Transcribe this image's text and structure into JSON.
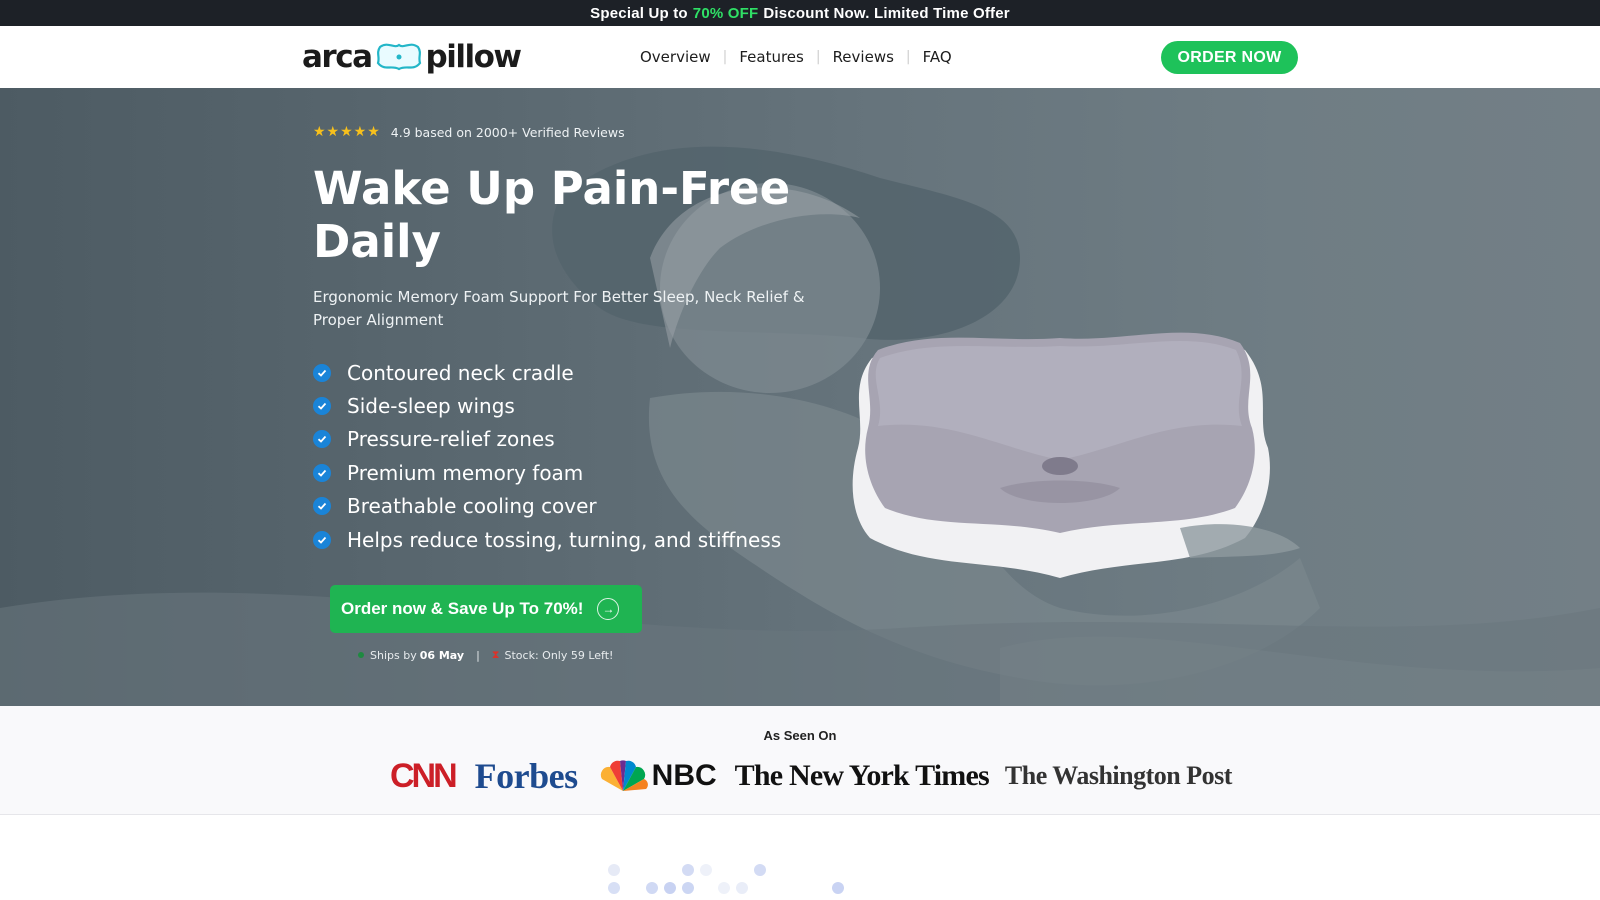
{
  "promo": {
    "prefix": "Special Up to",
    "highlight": "70% OFF",
    "suffix": "Discount Now. Limited Time Offer"
  },
  "header": {
    "logo_left": "arca",
    "logo_right": "pillow",
    "nav": [
      "Overview",
      "Features",
      "Reviews",
      "FAQ"
    ],
    "order_button": "ORDER NOW"
  },
  "hero": {
    "stars": "★★★★★",
    "rating_text": "4.9 based on 2000+ Verified Reviews",
    "headline": "Wake Up Pain-Free Daily",
    "subheadline": "Ergonomic Memory Foam Support For Better Sleep, Neck Relief & Proper Alignment",
    "features": [
      "Contoured neck cradle",
      "Side-sleep wings",
      "Pressure-relief zones",
      "Premium memory foam",
      "Breathable cooling cover",
      "Helps reduce tossing, turning, and stiffness"
    ],
    "cta": "Order now & Save Up To 70%!",
    "ships_label": "Ships by",
    "ships_date": "06 May",
    "stock": "Stock: Only 59 Left!"
  },
  "as_seen_on": {
    "title": "As Seen On",
    "logos": [
      "CNN",
      "Forbes",
      "NBC",
      "The New York Times",
      "The Washington Post"
    ]
  },
  "colors": {
    "accent_green": "#1ec25a",
    "promo_green": "#2fe066",
    "check_blue": "#1a84d8",
    "star": "#f7c01c"
  }
}
